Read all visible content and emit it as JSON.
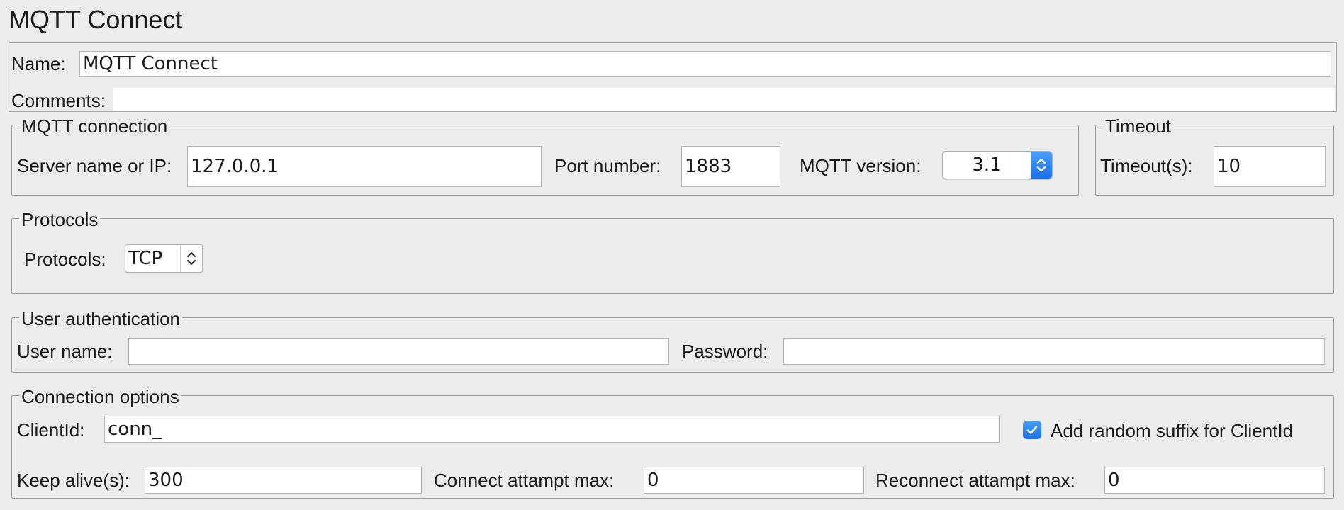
{
  "page": {
    "title": "MQTT Connect"
  },
  "general": {
    "name_label": "Name:",
    "name_value": "MQTT Connect",
    "comments_label": "Comments:",
    "comments_value": ""
  },
  "connection": {
    "legend": "MQTT connection",
    "server_label": "Server name or IP:",
    "server_value": "127.0.0.1",
    "port_label": "Port number:",
    "port_value": "1883",
    "version_label": "MQTT version:",
    "version_value": "3.1"
  },
  "timeout": {
    "legend": "Timeout",
    "label": "Timeout(s):",
    "value": "10"
  },
  "protocols": {
    "legend": "Protocols",
    "label": "Protocols:",
    "value": "TCP"
  },
  "auth": {
    "legend": "User authentication",
    "username_label": "User name:",
    "username_value": "",
    "password_label": "Password:",
    "password_value": ""
  },
  "options": {
    "legend": "Connection options",
    "clientid_label": "ClientId:",
    "clientid_value": "conn_",
    "random_suffix_label": "Add random suffix for ClientId",
    "random_suffix_checked": true,
    "keepalive_label": "Keep alive(s):",
    "keepalive_value": "300",
    "connect_max_label": "Connect attampt max:",
    "connect_max_value": "0",
    "reconnect_max_label": "Reconnect attampt max:",
    "reconnect_max_value": "0"
  },
  "colors": {
    "background": "#ececec",
    "accent": "#1b6fe8",
    "field": "#ffffff",
    "border": "#9c9c9c"
  }
}
